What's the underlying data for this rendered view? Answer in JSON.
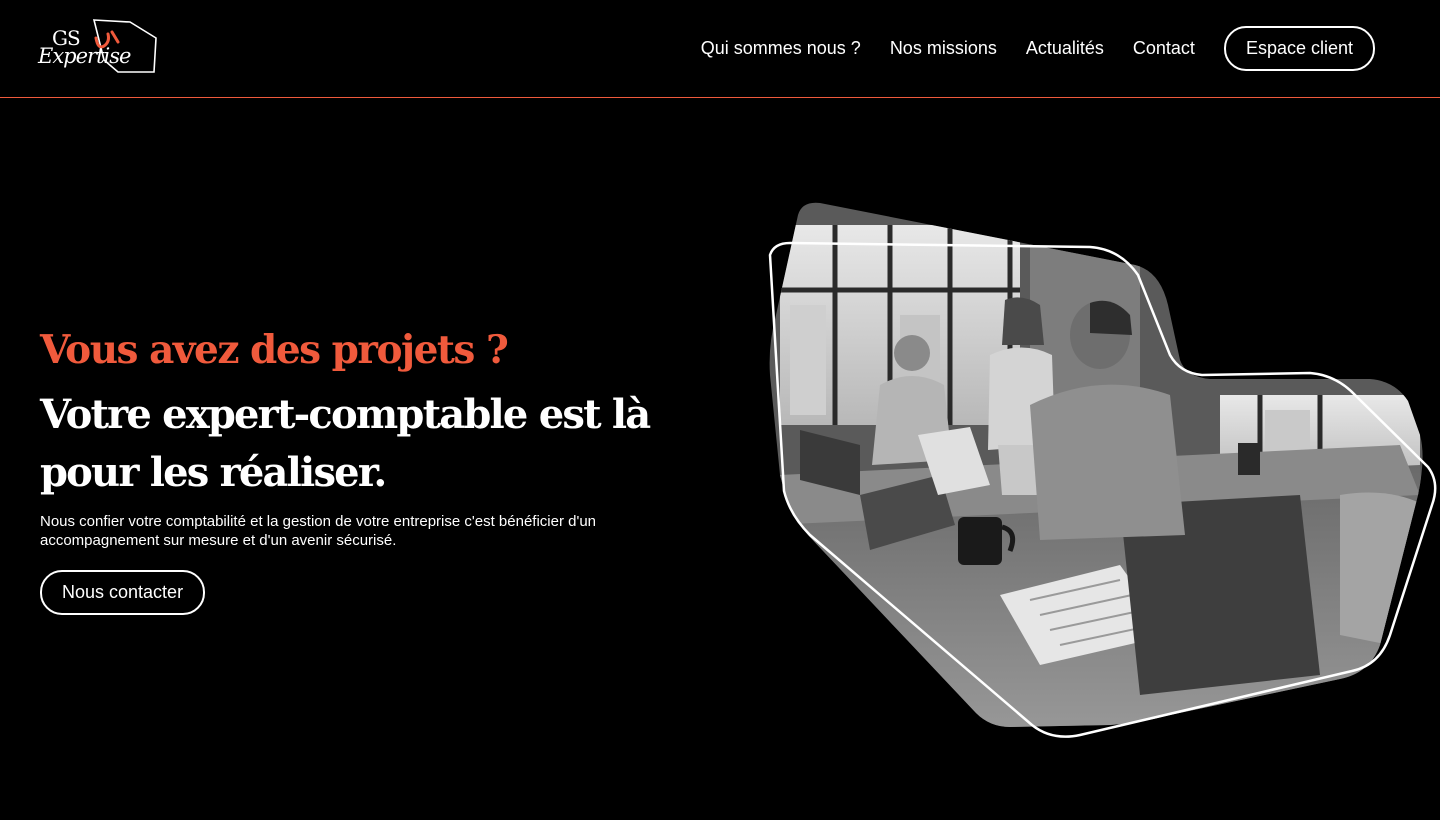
{
  "brand": {
    "logo_top": "GS",
    "logo_bottom": "Expertise",
    "accent_color": "#f05a3c"
  },
  "nav": {
    "items": [
      {
        "label": "Qui sommes nous ?"
      },
      {
        "label": "Nos missions"
      },
      {
        "label": "Actualités"
      },
      {
        "label": "Contact"
      }
    ],
    "cta_label": "Espace client"
  },
  "hero": {
    "kicker": "Vous avez des projets ?",
    "title": "Votre expert-comptable est là pour les réaliser.",
    "description": "Nous confier votre comptabilité et la gestion de votre entreprise c'est bénéficier d'un accompagnement sur mesure et d'un avenir sécurisé.",
    "cta_label": "Nous contacter",
    "image_icon": "office-meeting-photo"
  }
}
